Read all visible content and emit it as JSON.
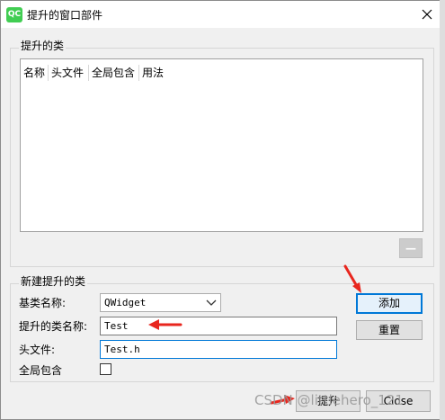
{
  "window": {
    "app_icon_text": "QC",
    "title": "提升的窗口部件",
    "close_glyph": "✕"
  },
  "promoted_classes": {
    "group_title": "提升的类",
    "columns": [
      "名称",
      "头文件",
      "全局包含",
      "用法"
    ],
    "remove_button_glyph": "—"
  },
  "new_promoted": {
    "group_title": "新建提升的类",
    "base_class_label": "基类名称:",
    "base_class_value": "QWidget",
    "class_name_label": "提升的类名称:",
    "class_name_value": "Test",
    "header_label": "头文件:",
    "header_value": "Test.h",
    "global_include_label": "全局包含",
    "add_button": "添加",
    "reset_button": "重置"
  },
  "footer": {
    "promote_button": "提升",
    "close_button": "Close"
  },
  "watermark": "CSDN @littlehero_121",
  "colors": {
    "accent": "#0078d7",
    "annotation_arrow": "#e8261e",
    "qt_green": "#41cd52"
  }
}
